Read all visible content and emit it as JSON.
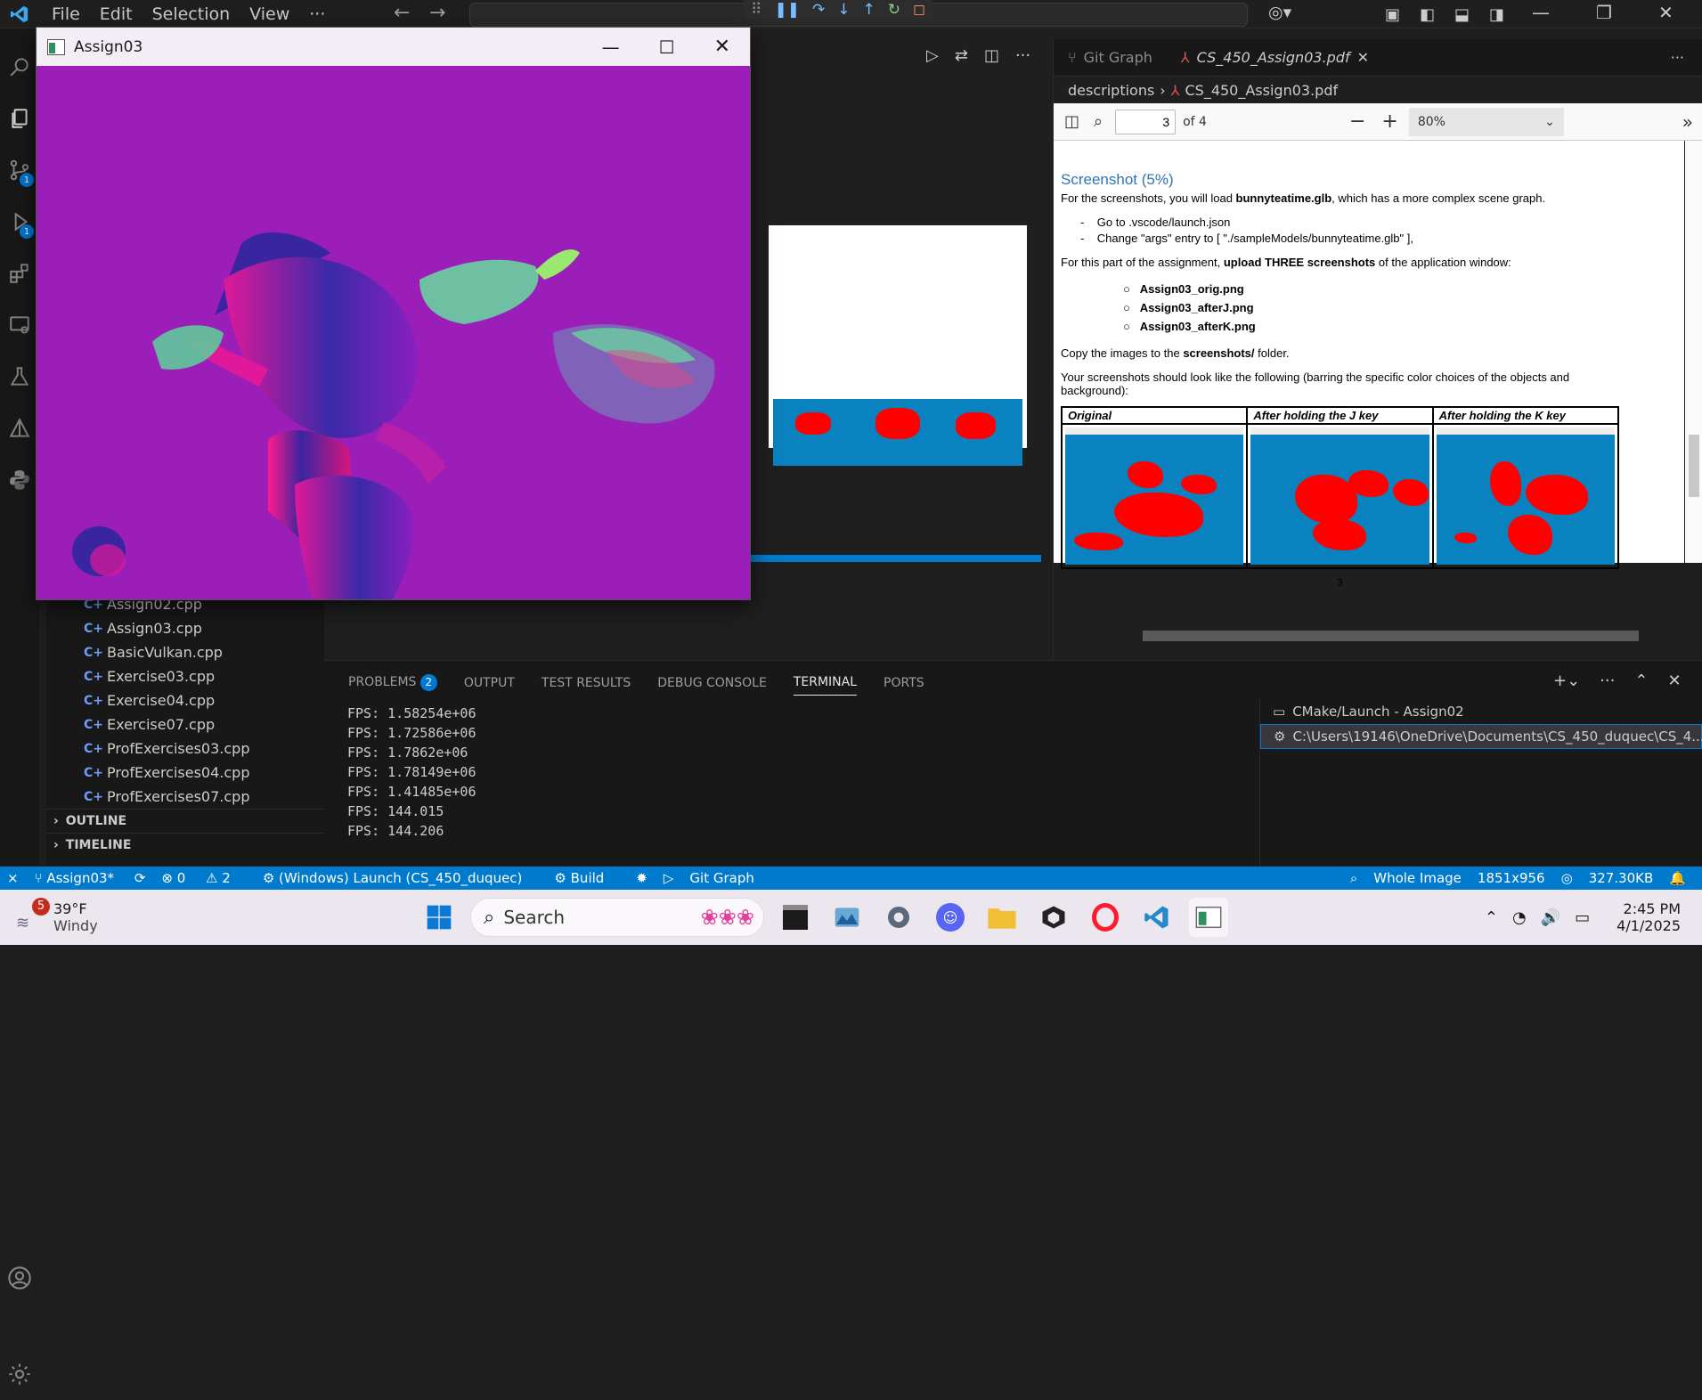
{
  "titlebar": {
    "menus": [
      "File",
      "Edit",
      "Selection",
      "View",
      "···"
    ],
    "window_controls": [
      "minimize",
      "restore",
      "close"
    ]
  },
  "activity_badges": {
    "source_control": "1",
    "run_debug": "1"
  },
  "app_window": {
    "title": "Assign03"
  },
  "explorer": {
    "files": [
      "Assign02.cpp",
      "Assign03.cpp",
      "BasicVulkan.cpp",
      "Exercise03.cpp",
      "Exercise04.cpp",
      "Exercise07.cpp",
      "ProfExercises03.cpp",
      "ProfExercises04.cpp",
      "ProfExercises07.cpp"
    ],
    "sections": [
      "OUTLINE",
      "TIMELINE"
    ]
  },
  "pdf": {
    "tabs": [
      {
        "label": "Git Graph"
      },
      {
        "label": "CS_450_Assign03.pdf"
      }
    ],
    "breadcrumb": {
      "folder": "descriptions",
      "file": "CS_450_Assign03.pdf"
    },
    "toolbar": {
      "page": "3",
      "of": "of 4",
      "zoom": "80%"
    },
    "content": {
      "heading": "Screenshot (5%)",
      "intro_prefix": "For the screenshots, you will load ",
      "intro_bold": "bunnyteatime.glb",
      "intro_suffix": ", which has a more complex scene graph.",
      "step1": "Go to .vscode/launch.json",
      "step2": "Change \"args\" entry to [ \"./sampleModels/bunnyteatime.glb\" ],",
      "upload_prefix": "For this part of the assignment, ",
      "upload_bold": "upload THREE screenshots",
      "upload_suffix": " of the application window:",
      "files": [
        "Assign03_orig.png",
        "Assign03_afterJ.png",
        "Assign03_afterK.png"
      ],
      "copy_prefix": "Copy the images to the ",
      "copy_bold": "screenshots/",
      "copy_suffix": " folder.",
      "look_text": "Your screenshots should look like the following (barring the specific color choices of the objects and background):",
      "table_headers": [
        "Original",
        "After holding the J key",
        "After holding the K key"
      ],
      "page_number": "3"
    }
  },
  "panel": {
    "tabs": [
      {
        "label": "PROBLEMS",
        "badge": "2"
      },
      {
        "label": "OUTPUT"
      },
      {
        "label": "TEST RESULTS"
      },
      {
        "label": "DEBUG CONSOLE"
      },
      {
        "label": "TERMINAL"
      },
      {
        "label": "PORTS"
      }
    ],
    "terminal_lines": [
      "FPS: 1.58254e+06",
      "FPS: 1.72586e+06",
      "FPS: 1.7862e+06",
      "FPS: 1.78149e+06",
      "FPS: 1.41485e+06",
      "FPS: 144.015",
      "FPS: 144.206"
    ],
    "terminals": [
      "CMake/Launch - Assign02",
      "C:\\Users\\19146\\OneDrive\\Documents\\CS_450_duquec\\CS_4..."
    ]
  },
  "statusbar": {
    "branch": "Assign03*",
    "errors": "0",
    "warnings": "2",
    "launch": "(Windows) Launch (CS_450_duquec)",
    "build": "Build",
    "gitgraph": "Git Graph",
    "whole_image": "Whole Image",
    "dimensions": "1851x956",
    "filesize": "327.30KB"
  },
  "taskbar": {
    "weather_badge": "5",
    "temperature": "39°F",
    "condition": "Windy",
    "search_placeholder": "Search",
    "time": "2:45 PM",
    "date": "4/1/2025"
  },
  "colors": {
    "statusbar": "#007acc",
    "app_background": "#9b1eb8",
    "pdf_heading": "#2e74b5",
    "screenshot_blue": "#0a82c0",
    "screenshot_red": "#ff0000"
  }
}
